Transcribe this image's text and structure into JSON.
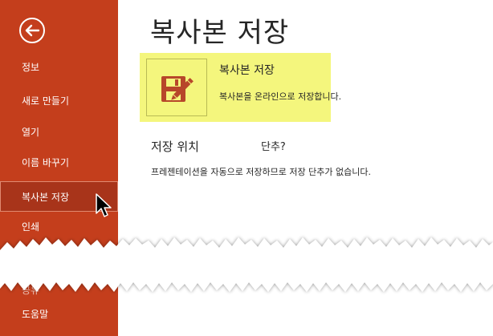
{
  "sidebar": {
    "back_icon": "back-arrow-icon",
    "items": [
      {
        "label": "정보",
        "selected": false
      },
      {
        "label": "새로 만들기",
        "selected": false
      },
      {
        "label": "열기",
        "selected": false
      },
      {
        "label": "이름 바꾸기",
        "selected": false
      },
      {
        "label": "복사본 저장",
        "selected": true
      },
      {
        "label": "인쇄",
        "selected": false
      },
      {
        "label": "공유",
        "selected": false
      },
      {
        "label": "도움말",
        "selected": false
      }
    ]
  },
  "main": {
    "title": "복사본 저장",
    "save_copy_card": {
      "icon": "floppy-disk-pencil-icon",
      "title": "복사본 저장",
      "description": "복사본을 온라인으로 저장합니다."
    },
    "location_section": {
      "heading": "저장 위치",
      "heading_extra": "단추?",
      "text": "프레젠테이션을 자동으로 저장하므로 저장 단추가 없습니다."
    }
  },
  "colors": {
    "sidebar": "#c43e1c",
    "sidebar_selected": "#a8341a",
    "highlight": "#f4f67d",
    "save_icon": "#b7472a"
  }
}
